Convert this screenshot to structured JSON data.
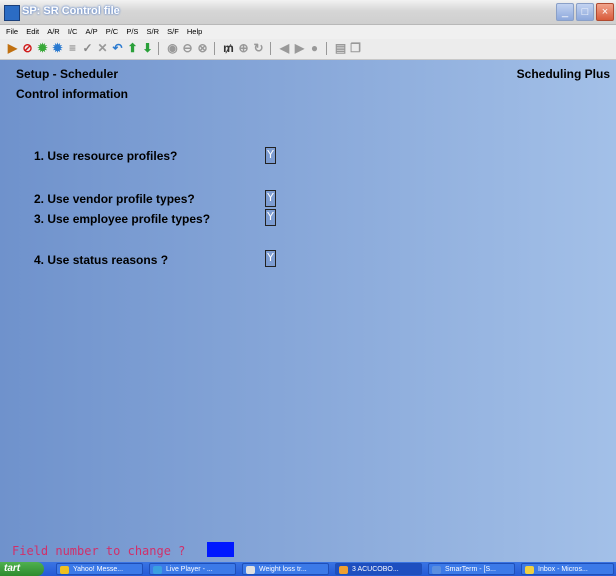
{
  "window": {
    "title": "SP: SR Control file"
  },
  "menu": [
    "File",
    "Edit",
    "A/R",
    "I/C",
    "A/P",
    "P/C",
    "P/S",
    "S/R",
    "S/F",
    "Help"
  ],
  "header": {
    "left": "Setup - Scheduler",
    "right": "Scheduling Plus",
    "subtitle": "Control information"
  },
  "fields": [
    {
      "label": "1. Use resource profiles?",
      "value": "Y"
    },
    {
      "label": "2. Use vendor profile types?",
      "value": "Y"
    },
    {
      "label": "3. Use employee profile types?",
      "value": "Y"
    },
    {
      "label": "4. Use status reasons ?",
      "value": "Y"
    }
  ],
  "prompt": "Field number to change ?",
  "taskbar": {
    "start": "tart",
    "tasks": [
      "Yahoo! Messe...",
      "Live Player - ...",
      "Weight loss tr...",
      "3 ACUCOBO...",
      "SmarTerm - [S...",
      "Inbox - Micros..."
    ]
  },
  "colors": {
    "accent": "#0018ff",
    "prompt": "#d0306a"
  }
}
